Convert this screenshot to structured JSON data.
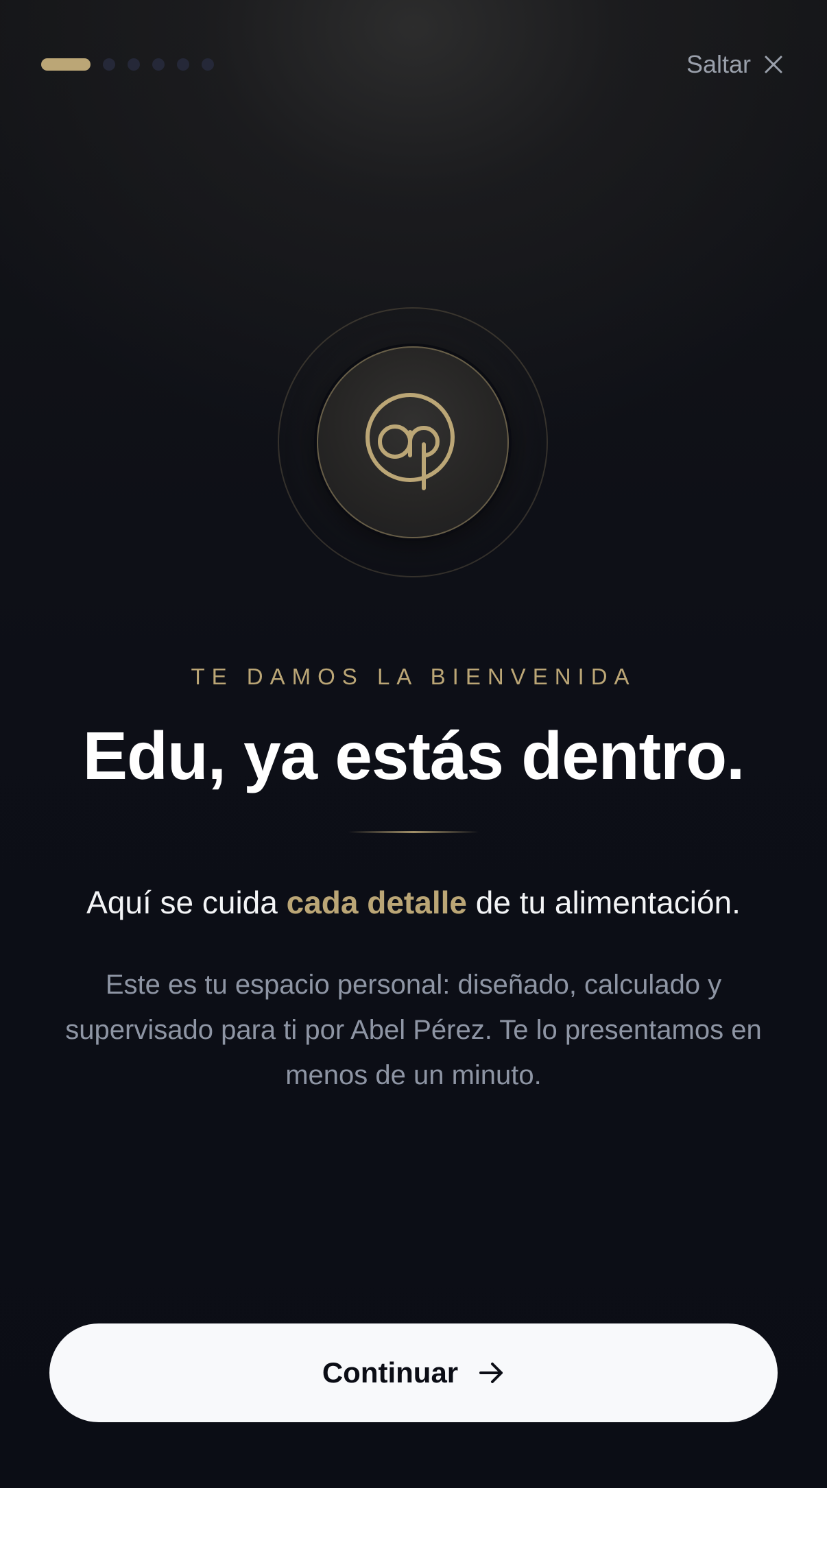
{
  "progress": {
    "current_step": 1,
    "total_steps": 6
  },
  "header": {
    "skip_label": "Saltar",
    "skip_icon": "close-icon"
  },
  "emblem": {
    "logo_icon": "ap-monogram-logo"
  },
  "welcome": {
    "eyebrow": "TE DAMOS LA BIENVENIDA",
    "title": "Edu, ya estás dentro.",
    "lead_before": "Aquí se cuida ",
    "lead_highlight": "cada detalle",
    "lead_after": " de tu alimentación.",
    "body": "Este es tu espacio personal: diseñado, calculado y supervisado para ti por Abel Pérez. Te lo presentamos en menos de un minuto."
  },
  "footer": {
    "continue_label": "Continuar",
    "continue_icon": "arrow-right-icon"
  },
  "colors": {
    "background": "#0b0d15",
    "accent_gold": "#bba676",
    "text_primary": "#ffffff",
    "text_muted": "#8e95a4",
    "button_bg": "#f8f9fb"
  }
}
